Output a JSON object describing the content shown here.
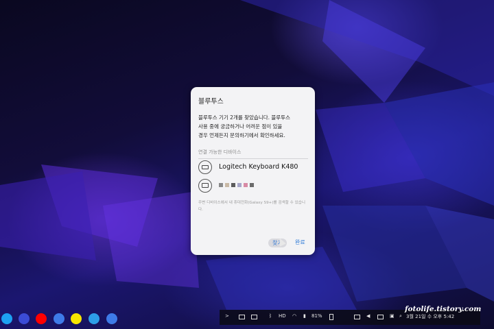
{
  "dialog": {
    "title": "블루투스",
    "message": "블루투스 기기 2개를 찾았습니다. 블루투스\n사용 중에 궁금하거나 어려운 점이 있을\n경우 언제든지 문의하기에서 확인하세요.",
    "section_label": "연결 가능한 디바이스",
    "devices": [
      {
        "name": "Logitech Keyboard K480",
        "icon": "keyboard-icon"
      },
      {
        "name": "",
        "icon": "monitor-icon"
      }
    ],
    "hint": "주변 디바이스에서 내 휴대전화(Galaxy S9+)를 검색할 수 있습니다.",
    "search_button": "찾기",
    "done_button": "완료"
  },
  "taskbar": {
    "apps": [
      {
        "icon": "twitter-icon",
        "color": "#1da1f2"
      },
      {
        "icon": "galaxy-planet-icon",
        "color": "#3b4bd6"
      },
      {
        "icon": "youtube-icon",
        "color": "#ff0000"
      },
      {
        "icon": "settings-gear-icon",
        "color": "#3e7be8"
      },
      {
        "icon": "kakaotalk-icon",
        "color": "#f7e600"
      },
      {
        "icon": "message-icon",
        "color": "#2d9ee8"
      },
      {
        "icon": "settings-gear-icon",
        "color": "#3e7be8"
      }
    ],
    "battery": "81%",
    "clock": "3월 21일 수 오후 5:42"
  },
  "watermark": "fotolife.tistory.com",
  "colors": {
    "accent": "#2b78d6",
    "dialog_bg": "#f3f3f5"
  }
}
